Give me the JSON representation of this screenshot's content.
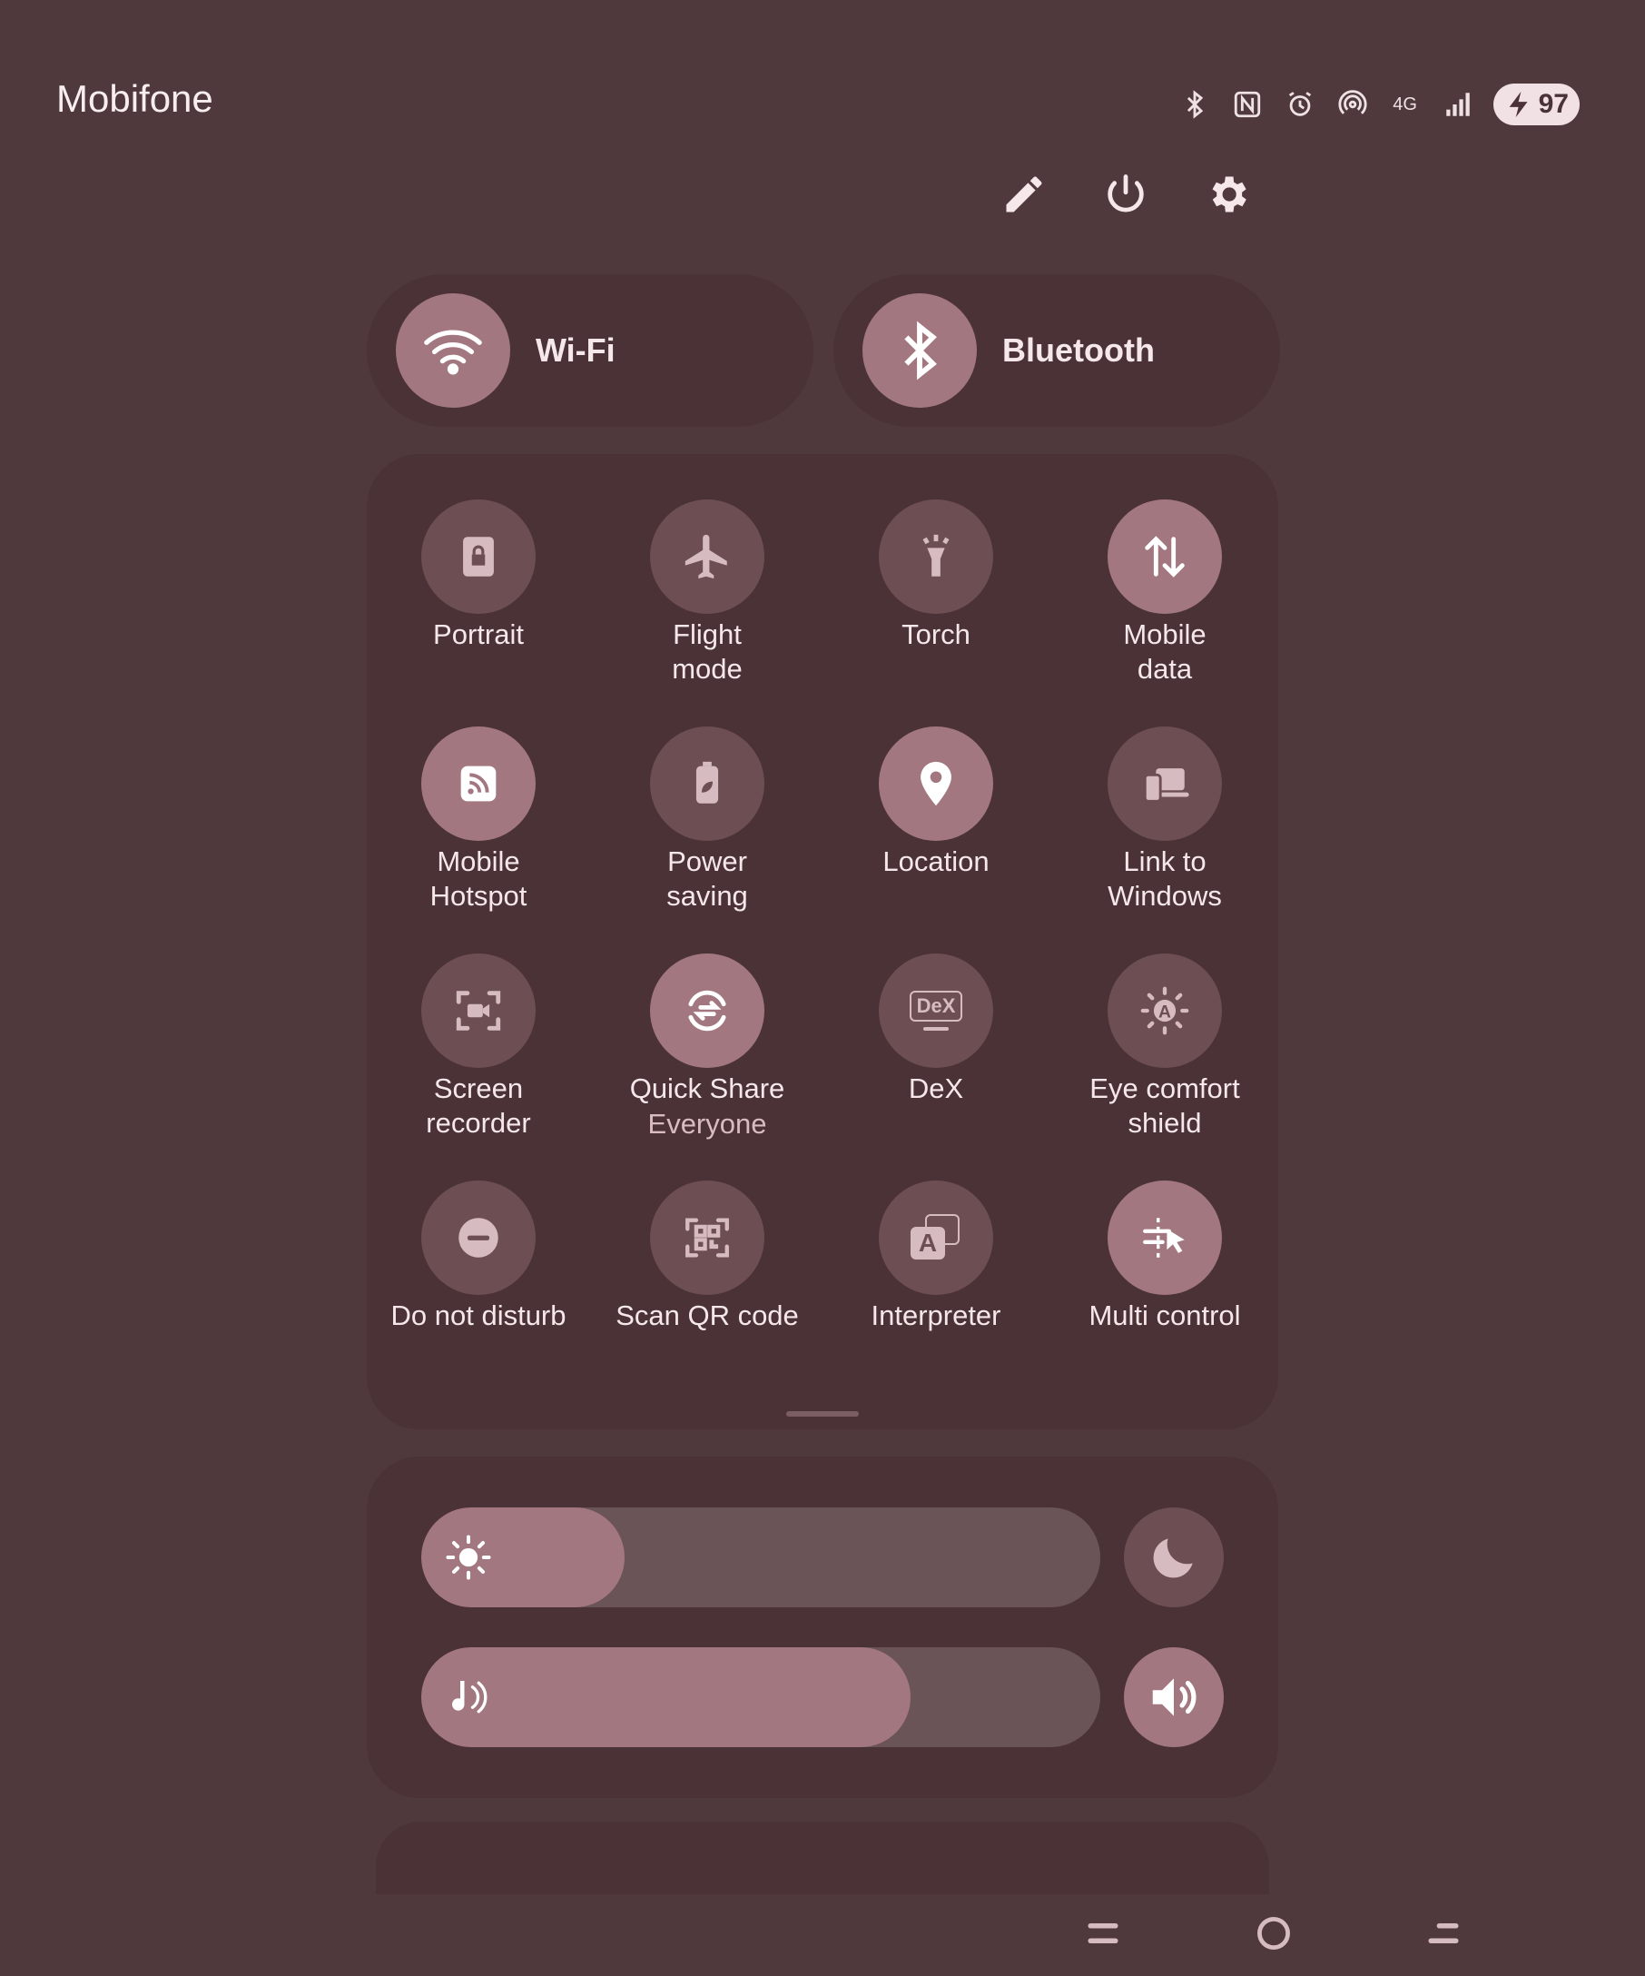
{
  "status_bar": {
    "carrier": "Mobifone",
    "network_type": "4G",
    "battery_level": "97",
    "icons": [
      "bluetooth-icon",
      "nfc-icon",
      "alarm-icon",
      "hotspot-icon",
      "network-4g-icon",
      "signal-icon",
      "battery-icon"
    ]
  },
  "top_actions": {
    "edit": "pencil-icon",
    "power": "power-icon",
    "settings": "settings-icon"
  },
  "toggles": {
    "wifi_label": "Wi-Fi",
    "bluetooth_label": "Bluetooth"
  },
  "tiles": {
    "portrait": "Portrait",
    "flight_1": "Flight",
    "flight_2": "mode",
    "torch": "Torch",
    "mobile_data_1": "Mobile",
    "mobile_data_2": "data",
    "hotspot_1": "Mobile",
    "hotspot_2": "Hotspot",
    "power_saving_1": "Power",
    "power_saving_2": "saving",
    "location": "Location",
    "link_windows_1": "Link to",
    "link_windows_2": "Windows",
    "screen_recorder_1": "Screen",
    "screen_recorder_2": "recorder",
    "quick_share": "Quick Share",
    "quick_share_sub": "Everyone",
    "dex": "DeX",
    "dex_icon_text": "DeX",
    "eye_comfort_1": "Eye comfort",
    "eye_comfort_2": "shield",
    "dnd": "Do not disturb",
    "scan_qr": "Scan QR code",
    "interpreter": "Interpreter",
    "interpreter_icon_text": "A",
    "multi_control": "Multi control"
  },
  "sliders": {
    "brightness_level": 0.3,
    "media_volume_level": 0.72
  },
  "colors": {
    "background": "#50393d",
    "panel": "#4a3236",
    "tile_on": "#a27780",
    "tile_off": "#6c4e53"
  }
}
